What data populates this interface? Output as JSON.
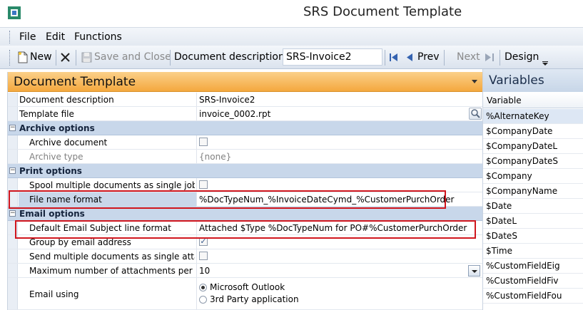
{
  "window": {
    "title": "SRS Document Template"
  },
  "menu": {
    "file": "File",
    "edit": "Edit",
    "functions": "Functions"
  },
  "toolbar": {
    "new": "New",
    "save_close": "Save and Close",
    "doc_desc_label": "Document description:",
    "doc_desc_value": "SRS-Invoice2",
    "prev": "Prev",
    "next": "Next",
    "design": "Design"
  },
  "panel": {
    "title": "Document Template",
    "rows": {
      "doc_desc": {
        "label": "Document description",
        "value": "SRS-Invoice2"
      },
      "template_file": {
        "label": "Template file",
        "value": "invoice_0002.rpt"
      },
      "archive_cat": "Archive options",
      "archive_doc": {
        "label": "Archive document"
      },
      "archive_type": {
        "label": "Archive type",
        "value": "{none}"
      },
      "print_cat": "Print options",
      "spool": {
        "label": "Spool multiple documents as single job"
      },
      "file_name_format": {
        "label": "File name format",
        "value": "%DocTypeNum_%InvoiceDateCymd_%CustomerPurchOrder"
      },
      "email_cat": "Email options",
      "email_subject": {
        "label": "Default Email Subject line format",
        "value": "Attached $Type %DocTypeNum for PO#%CustomerPurchOrder"
      },
      "group_email": {
        "label": "Group by email address"
      },
      "send_multi": {
        "label": "Send multiple documents as single attachment"
      },
      "max_attach": {
        "label": "Maximum number of attachments per email",
        "value": "10"
      },
      "email_using": {
        "label": "Email using",
        "opt1": "Microsoft Outlook",
        "opt2": "3rd Party application"
      }
    }
  },
  "variables": {
    "title": "Variables",
    "column": "Variable",
    "items": [
      "%AlternateKey",
      "$CompanyDate",
      "$CompanyDateL",
      "$CompanyDateS",
      "$Company",
      "$CompanyName",
      "$Date",
      "$DateL",
      "$DateS",
      "$Time",
      "%CustomFieldEig",
      "%CustomFieldFiv",
      "%CustomFieldFou"
    ]
  },
  "colors": {
    "accent_orange": "#f4a83e",
    "highlight_red": "#d0161e",
    "category_blue": "#c8d7ea"
  }
}
